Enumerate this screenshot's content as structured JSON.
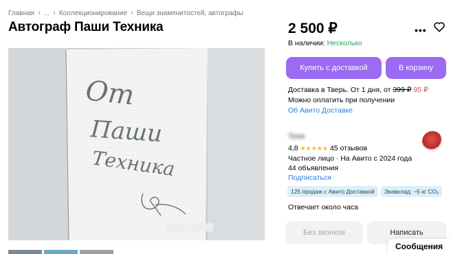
{
  "breadcrumb": {
    "items": [
      "Главная",
      "...",
      "Коллекционирование",
      "Вещи знаменитостей, автографы"
    ],
    "separator": "›"
  },
  "listing": {
    "title": "Автограф Паши Техника",
    "price": "2 500 ₽",
    "availability_label": "В наличии:",
    "availability_value": "Несколько",
    "photo_text": [
      "От",
      "Паши",
      "Техника"
    ]
  },
  "actions": {
    "buy_with_delivery": "Купить с доставкой",
    "add_to_cart": "В корзину",
    "more_icon": "more-dots-icon",
    "favorite_icon": "heart-icon"
  },
  "delivery": {
    "text": "Доставка в Тверь. От 1 дня, от",
    "old_price": "399 ₽",
    "new_price": "95 ₽",
    "payment": "Можно оплатить при получении",
    "link": "Об Авито Доставке"
  },
  "seller": {
    "name": "Тоня",
    "rating": "4,8",
    "stars": "★★★★★",
    "reviews": "45 отзывов",
    "type": "Частное лицо · На Авито с 2024 года",
    "listings": "44 объявления",
    "subscribe": "Подписаться",
    "badges": [
      "125 продаж с Авито Доставкой",
      "Экавклад: ~5 кг CO₂"
    ],
    "reply_time": "Отвечает около часа"
  },
  "contact": {
    "no_calls": "Без звонков",
    "write": "Написать",
    "messages": "Сообщения"
  },
  "colors": {
    "accent": "#9b6bf2",
    "link": "#2a7ee0",
    "success": "#1faa4f",
    "discount": "#e54545",
    "star": "#ffb21d"
  }
}
